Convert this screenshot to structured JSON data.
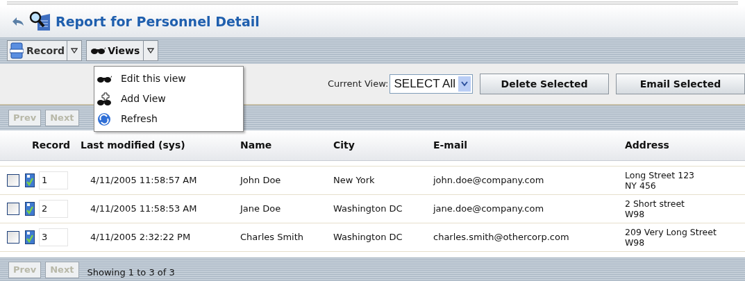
{
  "title": "Report for Personnel Detail",
  "toolbar": {
    "record_button": "Record",
    "views_button": "Views"
  },
  "views_menu": {
    "expanded": true,
    "items": [
      {
        "kind": "glasses",
        "label": "Edit this view"
      },
      {
        "kind": "add",
        "label": "Add View"
      },
      {
        "kind": "refresh",
        "label": "Refresh"
      }
    ]
  },
  "current_view": {
    "label": "Current View:",
    "value": "SELECT All"
  },
  "actions": [
    "Delete Selected",
    "Email Selected"
  ],
  "top_pager": {
    "prev": {
      "label": "Prev",
      "disabled": true
    },
    "next": {
      "label": "Next",
      "disabled": true
    }
  },
  "table": {
    "columns": [
      "Record",
      "Last modified (sys)",
      "Name",
      "City",
      "E-mail",
      "Address"
    ],
    "rows": [
      {
        "checked": false,
        "record": "1",
        "modified": "4/11/2005 11:58:57 AM",
        "name": "John Doe",
        "city": "New York",
        "email": "john.doe@company.com",
        "address": [
          "Long Street 123",
          "NY 456"
        ]
      },
      {
        "checked": false,
        "record": "2",
        "modified": "4/11/2005 11:58:53 AM",
        "name": "Jane Doe",
        "city": "Washington DC",
        "email": "jane.doe@company.com",
        "address": [
          "2 Short street",
          "W98"
        ]
      },
      {
        "checked": false,
        "record": "3",
        "modified": "4/11/2005 2:32:22 PM",
        "name": "Charles Smith",
        "city": "Washington DC",
        "email": "charles.smith@othercorp.com",
        "address": [
          "209 Very Long Street",
          "W98"
        ]
      }
    ]
  },
  "bottom_pager": {
    "prev": {
      "label": "Prev",
      "disabled": true
    },
    "next": {
      "label": "Next",
      "disabled": true
    },
    "status": "Showing 1 to 3 of 3"
  }
}
